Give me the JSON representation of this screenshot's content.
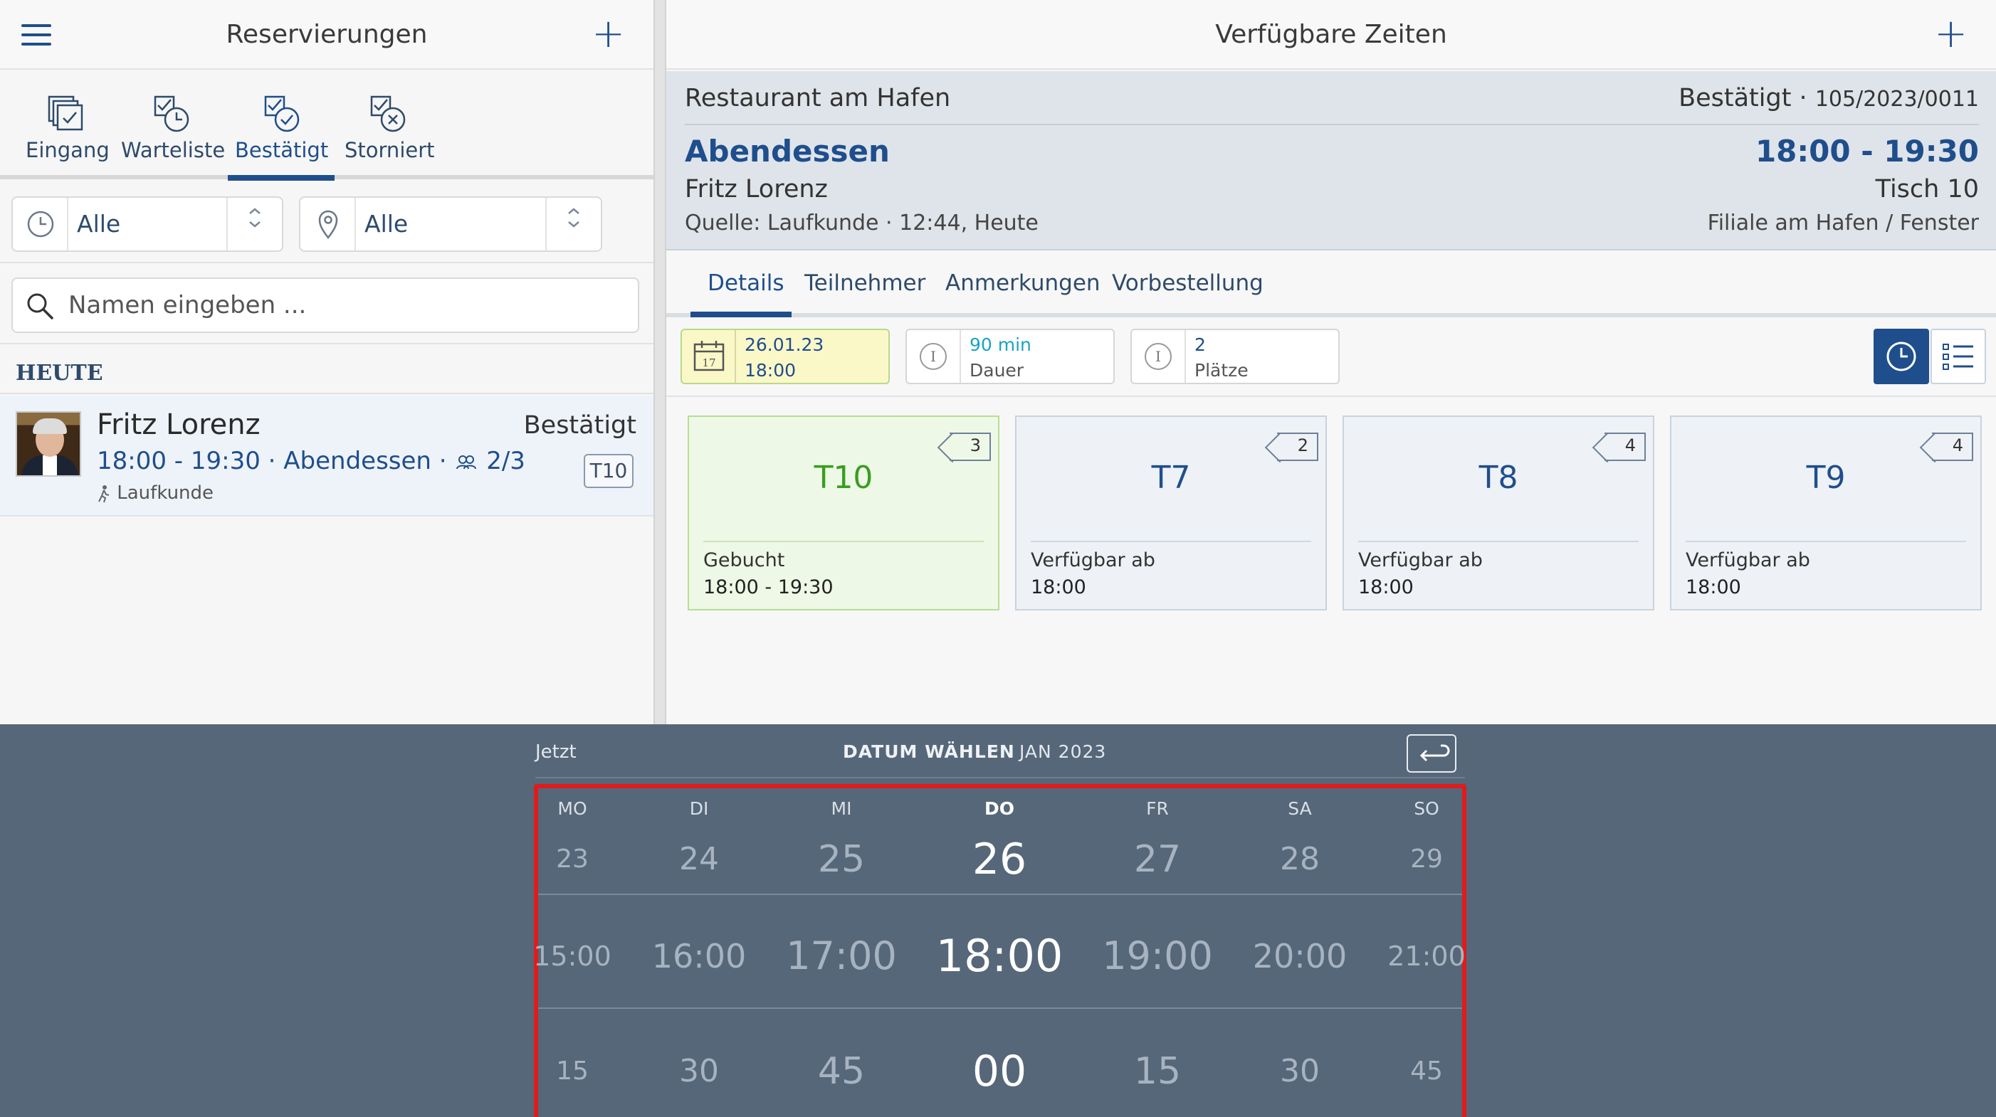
{
  "left": {
    "title": "Reservierungen",
    "add_label": "+",
    "status_tabs": [
      {
        "label": "Eingang",
        "icon": "inbox-icon"
      },
      {
        "label": "Warteliste",
        "icon": "waitlist-clock-icon"
      },
      {
        "label": "Bestätigt",
        "icon": "confirmed-check-icon"
      },
      {
        "label": "Storniert",
        "icon": "cancelled-x-icon"
      }
    ],
    "active_tab": "Bestätigt",
    "filters": {
      "time_value": "Alle",
      "location_value": "Alle",
      "arrows": "⌃\n⌄"
    },
    "search": {
      "placeholder": "Namen eingeben ..."
    },
    "section": "HEUTE",
    "reservation": {
      "name": "Fritz Lorenz",
      "status": "Bestätigt",
      "details": "18:00 - 19:30 · Abendessen ·",
      "guests": "2/3",
      "source": "Laufkunde",
      "table": "T10"
    }
  },
  "right": {
    "title": "Verfügbare Zeiten",
    "add_label": "+",
    "restaurant": "Restaurant am Hafen",
    "status": "Bestätigt ·",
    "booking_number": "105/2023/0011",
    "meal": "Abendessen",
    "time_range": "18:00 - 19:30",
    "guest": "Fritz Lorenz",
    "table": "Tisch 10",
    "source": "Quelle: Laufkunde · 12:44, Heute",
    "location": "Filiale am Hafen / Fenster",
    "tabs": [
      "Details",
      "Teilnehmer",
      "Anmerkungen",
      "Vorbestellung"
    ],
    "info": {
      "date": "26.01.23",
      "time": "18:00",
      "calendar_day": "17",
      "duration": "90 min",
      "duration_label": "Dauer",
      "seats": "2",
      "seats_label": "Plätze",
      "info_glyph": "I"
    },
    "tables": [
      {
        "name": "T10",
        "seats": "3",
        "status": "Gebucht",
        "time": "18:00 - 19:30",
        "booked": true
      },
      {
        "name": "T7",
        "seats": "2",
        "status": "Verfügbar ab",
        "time": "18:00",
        "booked": false
      },
      {
        "name": "T8",
        "seats": "4",
        "status": "Verfügbar ab",
        "time": "18:00",
        "booked": false
      },
      {
        "name": "T9",
        "seats": "4",
        "status": "Verfügbar ab",
        "time": "18:00",
        "booked": false
      }
    ]
  },
  "picker": {
    "now_label": "Jetzt",
    "title": "DATUM WÄHLEN",
    "dot": "·",
    "month": "JAN 2023",
    "weekdays": [
      "MO",
      "DI",
      "MI",
      "DO",
      "FR",
      "SA",
      "SO"
    ],
    "days": [
      "23",
      "24",
      "25",
      "26",
      "27",
      "28",
      "29"
    ],
    "hours": [
      "15:00",
      "16:00",
      "17:00",
      "18:00",
      "19:00",
      "20:00",
      "21:00"
    ],
    "minutes": [
      "15",
      "30",
      "45",
      "00",
      "15",
      "30",
      "45"
    ],
    "selected_index": 3
  },
  "colors": {
    "accent": "#1f4e8c",
    "booked_green": "#3a9d22",
    "picker_bg": "#566779",
    "highlight_frame": "#e01b1b"
  }
}
